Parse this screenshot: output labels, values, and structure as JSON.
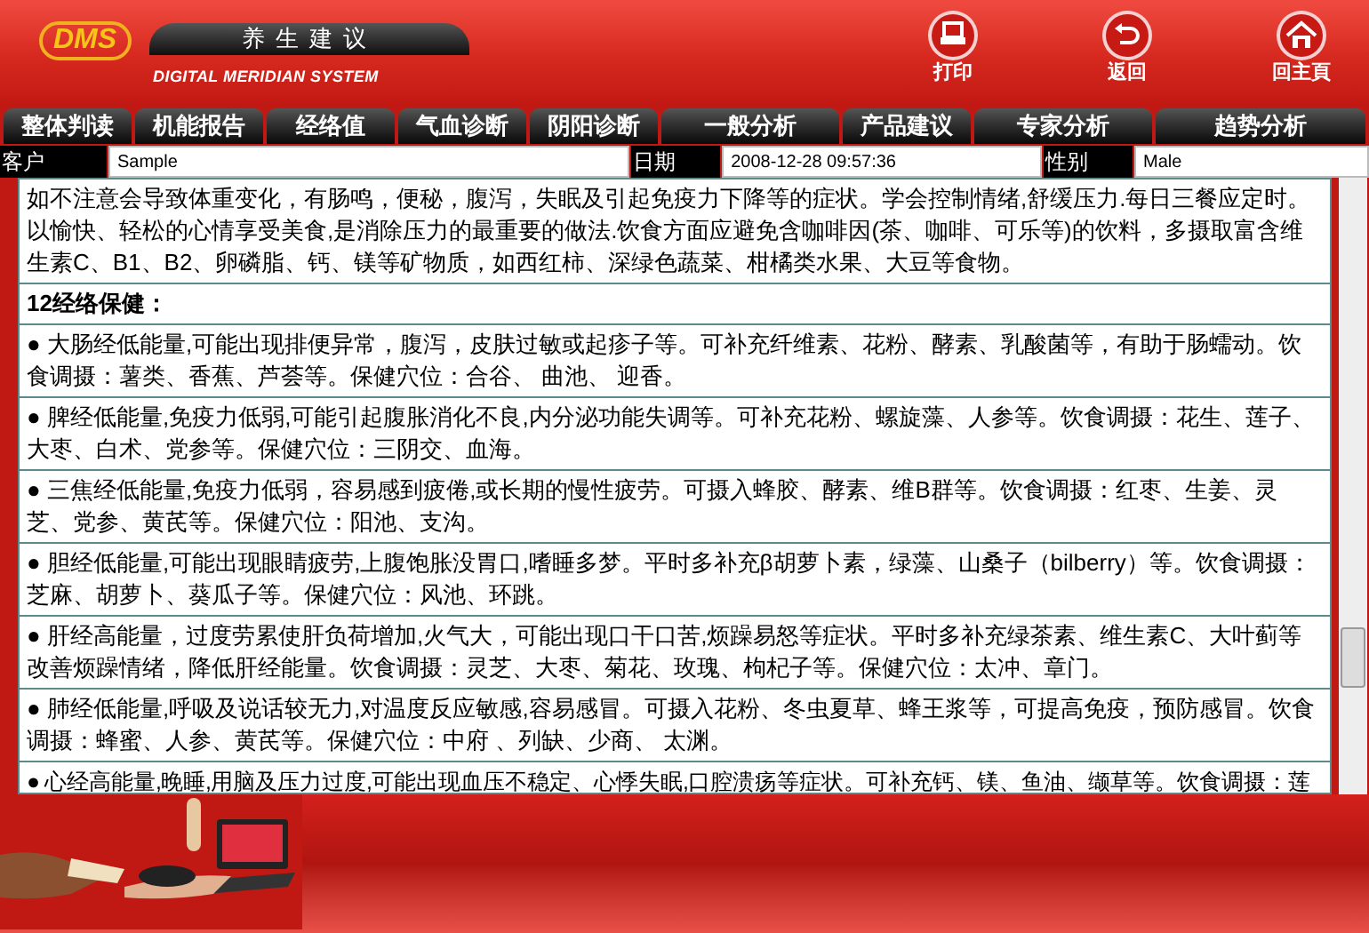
{
  "header": {
    "title": "养生建议",
    "logo_text": "DMS",
    "subtitle": "DIGITAL MERIDIAN SYSTEM",
    "actions": [
      {
        "kind": "print",
        "label": "打印"
      },
      {
        "kind": "back",
        "label": "返回"
      },
      {
        "kind": "home",
        "label": "回主頁"
      }
    ]
  },
  "tabs": [
    "整体判读",
    "机能报告",
    "经络值",
    "气血诊断",
    "阴阳诊断",
    "一般分析",
    "产品建议",
    "专家分析",
    "趋势分析"
  ],
  "info": [
    {
      "label": "客户",
      "value": "Sample"
    },
    {
      "label": "日期",
      "value": "2008-12-28 09:57:36"
    },
    {
      "label": "性别",
      "value": "Male"
    }
  ],
  "content": [
    {
      "kind": "text",
      "text": "如不注意会导致体重变化，有肠鸣，便秘，腹泻，失眠及引起免疫力下降等的症状。学会控制情绪,舒缓压力.每日三餐应定时。以愉快、轻松的心情享受美食,是消除压力的最重要的做法.饮食方面应避免含咖啡因(茶、咖啡、可乐等)的饮料，多摄取富含维生素C、B1、B2、卵磷脂、钙、镁等矿物质，如西红柿、深绿色蔬菜、柑橘类水果、大豆等食物。"
    },
    {
      "kind": "heading",
      "text": "12经络保健："
    },
    {
      "kind": "text",
      "text": "● 大肠经低能量,可能出现排便异常，腹泻，皮肤过敏或起疹子等。可补充纤维素、花粉、酵素、乳酸菌等，有助于肠蠕动。饮食调摄：薯类、香蕉、芦荟等。保健穴位：合谷、 曲池、 迎香。"
    },
    {
      "kind": "text",
      "text": "● 脾经低能量,免疫力低弱,可能引起腹胀消化不良,内分泌功能失调等。可补充花粉、螺旋藻、人参等。饮食调摄：花生、莲子、大枣、白术、党参等。保健穴位：三阴交、血海。"
    },
    {
      "kind": "text",
      "text": "● 三焦经低能量,免疫力低弱，容易感到疲倦,或长期的慢性疲劳。可摄入蜂胶、酵素、维B群等。饮食调摄：红枣、生姜、灵芝、党参、黄芪等。保健穴位：阳池、支沟。"
    },
    {
      "kind": "text",
      "text": "● 胆经低能量,可能出现眼睛疲劳,上腹饱胀没胃口,嗜睡多梦。平时多补充β胡萝卜素，绿藻、山桑子（bilberry）等。饮食调摄：芝麻、胡萝卜、葵瓜子等。保健穴位：风池、环跳。"
    },
    {
      "kind": "text",
      "text": "● 肝经高能量，过度劳累使肝负荷增加,火气大，可能出现口干口苦,烦躁易怒等症状。平时多补充绿茶素、维生素C、大叶蓟等改善烦躁情绪，降低肝经能量。饮食调摄：灵芝、大枣、菊花、玫瑰、枸杞子等。保健穴位：太冲、章门。"
    },
    {
      "kind": "text",
      "text": "● 肺经低能量,呼吸及说话较无力,对温度反应敏感,容易感冒。可摄入花粉、冬虫夏草、蜂王浆等，可提高免疫，预防感冒。饮食调摄：蜂蜜、人参、黄芪等。保健穴位：中府 、列缺、少商、 太渊。"
    },
    {
      "kind": "text",
      "text": "● 心经高能量,晚睡,用脑及压力过度,可能出现血压不稳定、心悸失眠,口腔溃疡等症状。可补充钙、镁、鱼油、缬草等。饮食调摄：莲"
    }
  ]
}
